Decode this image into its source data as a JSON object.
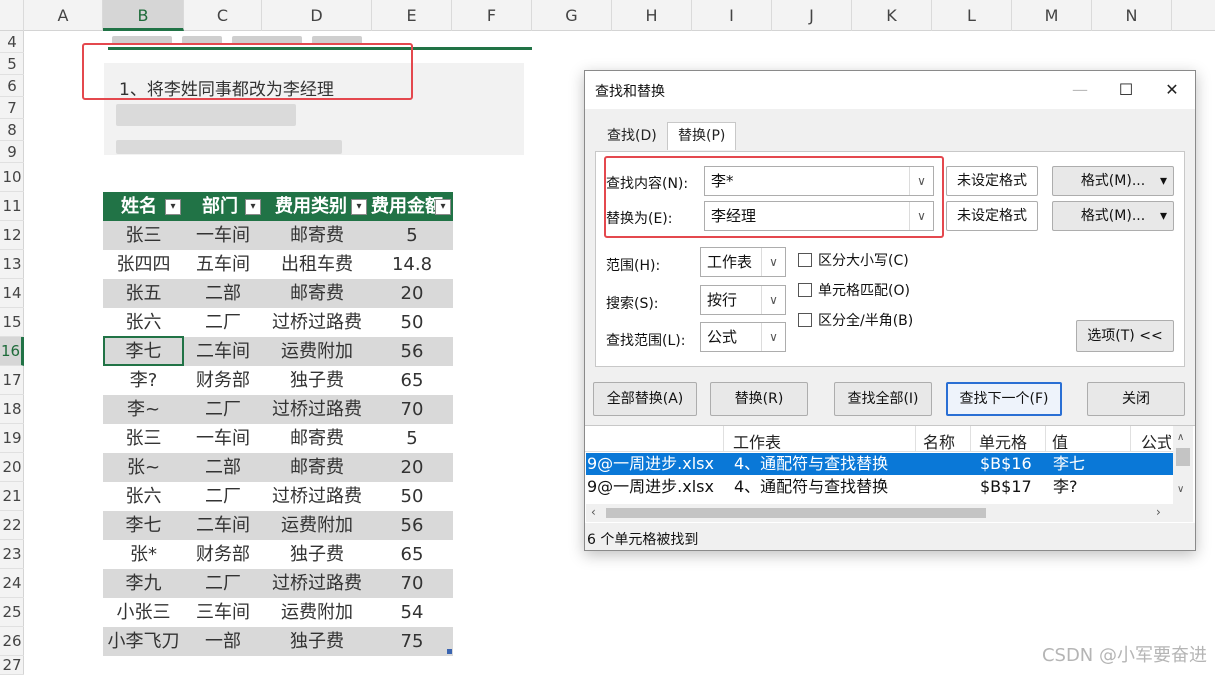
{
  "sheet": {
    "columns": [
      "A",
      "B",
      "C",
      "D",
      "E",
      "F",
      "G",
      "H",
      "I",
      "J",
      "K",
      "L",
      "M",
      "N"
    ],
    "rows": [
      "4",
      "5",
      "6",
      "7",
      "8",
      "9",
      "10",
      "11",
      "12",
      "13",
      "14",
      "15",
      "16",
      "17",
      "18",
      "19",
      "20",
      "21",
      "22",
      "23",
      "24",
      "25",
      "26",
      "27"
    ],
    "note": "1、将李姓同事都改为李经理",
    "table": {
      "headers": [
        "姓名",
        "部门",
        "费用类别",
        "费用金额"
      ],
      "rows": [
        [
          "张三",
          "一车间",
          "邮寄费",
          "5"
        ],
        [
          "张四四",
          "五车间",
          "出租车费",
          "14.8"
        ],
        [
          "张五",
          "二部",
          "邮寄费",
          "20"
        ],
        [
          "张六",
          "二厂",
          "过桥过路费",
          "50"
        ],
        [
          "李七",
          "二车间",
          "运费附加",
          "56"
        ],
        [
          "李?",
          "财务部",
          "独子费",
          "65"
        ],
        [
          "李~",
          "二厂",
          "过桥过路费",
          "70"
        ],
        [
          "张三",
          "一车间",
          "邮寄费",
          "5"
        ],
        [
          "张~",
          "二部",
          "邮寄费",
          "20"
        ],
        [
          "张六",
          "二厂",
          "过桥过路费",
          "50"
        ],
        [
          "李七",
          "二车间",
          "运费附加",
          "56"
        ],
        [
          "张*",
          "财务部",
          "独子费",
          "65"
        ],
        [
          "李九",
          "二厂",
          "过桥过路费",
          "70"
        ],
        [
          "小张三",
          "三车间",
          "运费附加",
          "54"
        ],
        [
          "小李飞刀",
          "一部",
          "独子费",
          "75"
        ]
      ]
    },
    "accent": "#217346"
  },
  "dialog": {
    "title": "查找和替换",
    "minimize": "—",
    "maximize": "☐",
    "close": "✕",
    "tabs": [
      "查找(D)",
      "替换(P)"
    ],
    "active_tab": "替换(P)",
    "find_label": "查找内容(N):",
    "find_value": "李*",
    "replace_label": "替换为(E):",
    "replace_value": "李经理",
    "no_format": "未设定格式",
    "format_btn": "格式(M)...",
    "format_arrow": "▾",
    "scope_label": "范围(H):",
    "scope_value": "工作表",
    "search_label": "搜索(S):",
    "search_value": "按行",
    "lookin_label": "查找范围(L):",
    "lookin_value": "公式",
    "match_case": "区分大小写(C)",
    "match_cell": "单元格匹配(O)",
    "match_width": "区分全/半角(B)",
    "options_btn": "选项(T) <<",
    "replace_all": "全部替换(A)",
    "replace": "替换(R)",
    "find_all": "查找全部(I)",
    "find_next": "查找下一个(F)",
    "close_btn": "关闭",
    "results": {
      "headers": [
        "工作表",
        "名称",
        "单元格",
        "值",
        "公式"
      ],
      "rows": [
        {
          "book": "9@一周进步.xlsx",
          "sheet": "4、通配符与查找替换",
          "cell": "$B$16",
          "value": "李七"
        },
        {
          "book": "9@一周进步.xlsx",
          "sheet": "4、通配符与查找替换",
          "cell": "$B$17",
          "value": "李?"
        }
      ]
    },
    "status": "6 个单元格被找到"
  },
  "watermark": "CSDN @小军要奋进",
  "highlight_color": "#e4484e",
  "selection_color": "#0a78d7"
}
